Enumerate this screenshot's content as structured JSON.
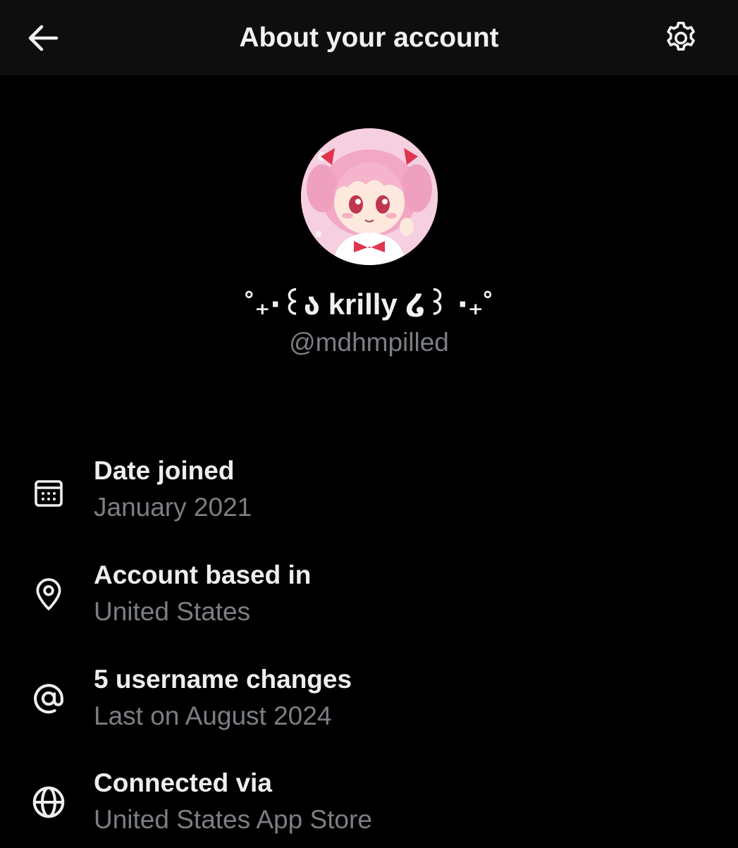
{
  "header": {
    "title": "About your account",
    "back_icon": "arrow-left-icon",
    "settings_icon": "gear-icon"
  },
  "profile": {
    "display_name": "˚₊‧꒰ა krilly ໒꒱ ‧₊˚",
    "handle": "@mdhmpilled",
    "avatar": "anime-character-avatar"
  },
  "details": [
    {
      "icon": "calendar-icon",
      "label": "Date joined",
      "value": "January 2021"
    },
    {
      "icon": "location-pin-icon",
      "label": "Account based in",
      "value": "United States"
    },
    {
      "icon": "at-sign-icon",
      "label": "5 username changes",
      "value": "Last on August 2024"
    },
    {
      "icon": "globe-icon",
      "label": "Connected via",
      "value": "United States App Store"
    }
  ],
  "colors": {
    "background": "#000000",
    "header_background": "#0e0e0e",
    "primary_text": "#eeeeee",
    "secondary_text": "#7b7f84"
  }
}
